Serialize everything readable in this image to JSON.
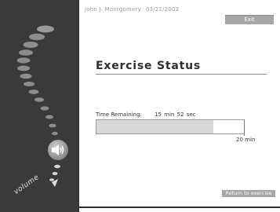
{
  "header": {
    "user_name": "John J. Montgomery",
    "date": "03/21/2003"
  },
  "toolbar": {
    "exit_label": "Exit"
  },
  "main": {
    "title": "Exercise Status",
    "time_remaining_label": "Time Remaining:",
    "time_remaining_value": "15 min  52 sec",
    "progress_fraction": 0.79,
    "progress_end_label": "20 min",
    "return_label": "Return to exercise"
  },
  "sidebar": {
    "volume_label": "volume",
    "volume_icon": "speaker-icon"
  },
  "colors": {
    "panel": "#3a3a3a",
    "button": "#a6a6a6",
    "progress_fill": "#d9d9d9"
  }
}
